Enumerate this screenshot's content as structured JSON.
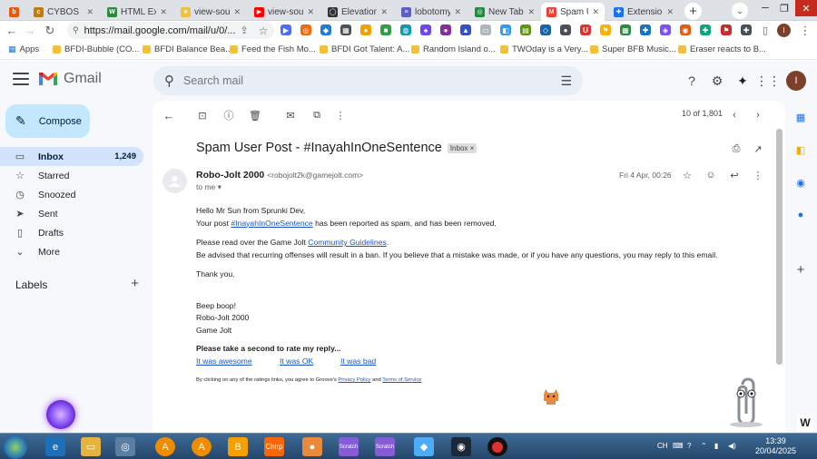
{
  "browser": {
    "tabs": [
      {
        "label": "",
        "color": "#e8590c",
        "glyph": "b"
      },
      {
        "label": "CYBOS",
        "color": "#c27c0e",
        "glyph": "c"
      },
      {
        "label": "HTML Exam",
        "color": "#2b8a3e",
        "glyph": "W"
      },
      {
        "label": "view-source",
        "color": "#f2c13b",
        "glyph": "★"
      },
      {
        "label": "view-source",
        "color": "#ff0000",
        "glyph": "▶"
      },
      {
        "label": "Elevation",
        "color": "#333333",
        "glyph": "◯"
      },
      {
        "label": "lobotomy",
        "color": "#5b5fc7",
        "glyph": "≡"
      },
      {
        "label": "New Tab",
        "color": "#1e8e3e",
        "glyph": "◎"
      },
      {
        "label": "Spam User",
        "color": "#ea4335",
        "glyph": "M"
      },
      {
        "label": "Extensions",
        "color": "#1a73e8",
        "glyph": "✚"
      }
    ],
    "new_tab": "+",
    "url": "https://mail.google.com/mail/u/0/...",
    "bookmarks": [
      {
        "label": "Apps"
      },
      {
        "label": "BFDI-Bubble (CO..."
      },
      {
        "label": "BFDI Balance Bea..."
      },
      {
        "label": "Feed the Fish Mo..."
      },
      {
        "label": "BFDI Got Talent: A..."
      },
      {
        "label": "Random Island o..."
      },
      {
        "label": "TWOday is a Very..."
      },
      {
        "label": "Super BFB Music..."
      },
      {
        "label": "Eraser reacts to B..."
      }
    ]
  },
  "gmail": {
    "logo_text": "Gmail",
    "search_placeholder": "Search mail",
    "avatar_letter": "I",
    "compose_label": "Compose",
    "nav": [
      {
        "label": "Inbox",
        "count": "1,249",
        "icon": "inbox-icon",
        "glyph": "▭"
      },
      {
        "label": "Starred",
        "count": "",
        "icon": "star-icon",
        "glyph": "☆"
      },
      {
        "label": "Snoozed",
        "count": "",
        "icon": "clock-icon",
        "glyph": "◷"
      },
      {
        "label": "Sent",
        "count": "",
        "icon": "send-icon",
        "glyph": "➤"
      },
      {
        "label": "Drafts",
        "count": "",
        "icon": "draft-icon",
        "glyph": "▯"
      },
      {
        "label": "More",
        "count": "",
        "icon": "chevron-down-icon",
        "glyph": "⌄"
      }
    ],
    "labels_heading": "Labels",
    "pager": "10 of 1,801"
  },
  "email": {
    "subject": "Spam User Post - #InayahInOneSentence",
    "label_chip": "Inbox ×",
    "sender_name": "Robo-Jolt 2000",
    "sender_email": "<robojolt2k@gamejolt.com>",
    "to": "to me",
    "date": "Fri 4 Apr, 00:26",
    "greeting": "Hello Mr Sun from Sprunki Dev,",
    "line1_a": "Your post ",
    "line1_link": "#InayahInOneSentence",
    "line1_b": " has been reported as spam, and has been removed.",
    "line2_a": "Please read over the Game Jolt ",
    "line2_link": "Community Guidelines",
    "line2_b": ".",
    "line3": "Be advised that recurring offenses will result in a ban. If you believe that a mistake was made, or if you have any questions, you may reply to this email.",
    "thanks": "Thank you.",
    "sig1": "Beep boop!",
    "sig2": "Robo-Jolt 2000",
    "sig3": "Game Jolt",
    "rate_prompt": "Please take a second to rate my reply...",
    "rate_options": [
      "It was awesome",
      "It was OK",
      "It was bad"
    ],
    "fine_a": "By clicking on any of the ratings links, you agree to Groove's ",
    "fine_link1": "Privacy Policy",
    "fine_and": " and ",
    "fine_link2": "Terms of Service"
  },
  "taskbar": {
    "time": "13:39",
    "date": "20/04/2025",
    "lang": "CH"
  },
  "colors": {
    "accent": "#1a73e8",
    "compose": "#c2e7ff",
    "inbox_active": "#d3e3fd"
  }
}
